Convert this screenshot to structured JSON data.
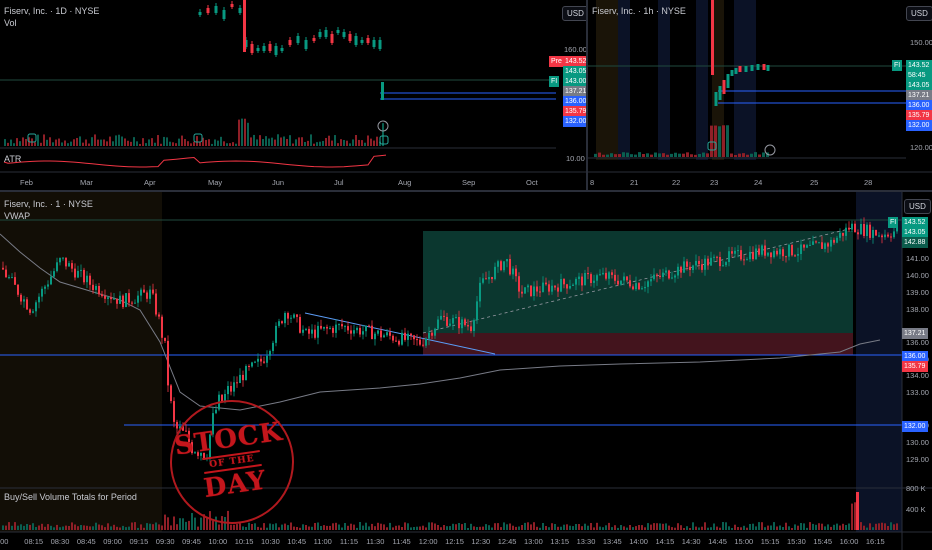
{
  "top_left": {
    "title": "Fiserv, Inc. · 1D · NYSE",
    "vol_label": "Vol",
    "atr_label": "ATR",
    "currency": "USD",
    "y_labels": [
      "160.00",
      "10.00"
    ],
    "x_labels": [
      "Feb",
      "Mar",
      "Apr",
      "May",
      "Jun",
      "Jul",
      "Aug",
      "Sep",
      "Oct"
    ],
    "price_tags": [
      {
        "text": "Pre",
        "text2": "143.52",
        "color": "#f23645"
      },
      {
        "text": "",
        "text2": "143.05",
        "color": "#089981"
      },
      {
        "text": "FI",
        "text2": "143.00",
        "color": "#089981"
      },
      {
        "text": "",
        "text2": "137.21",
        "color": "#787b86"
      },
      {
        "text": "",
        "text2": "136.00",
        "color": "#2962ff"
      },
      {
        "text": "",
        "text2": "135.79",
        "color": "#f23645"
      },
      {
        "text": "",
        "text2": "132.00",
        "color": "#2962ff"
      }
    ]
  },
  "top_right": {
    "title": "Fiserv, Inc. · 1h · NYSE",
    "currency": "USD",
    "y_labels": [
      "150.00",
      "120.00"
    ],
    "x_labels": [
      "8",
      "21",
      "22",
      "23",
      "24",
      "25",
      "28"
    ],
    "price_tags": [
      {
        "text": "FI",
        "text2": "143.52",
        "color": "#089981"
      },
      {
        "text": "",
        "text2": "58:45",
        "color": "#089981"
      },
      {
        "text": "",
        "text2": "143.05",
        "color": "#089981"
      },
      {
        "text": "",
        "text2": "137.21",
        "color": "#787b86"
      },
      {
        "text": "",
        "text2": "136.00",
        "color": "#2962ff"
      },
      {
        "text": "",
        "text2": "135.79",
        "color": "#f23645"
      },
      {
        "text": "",
        "text2": "132.00",
        "color": "#2962ff"
      }
    ]
  },
  "main": {
    "title": "Fiserv, Inc. · 1 · NYSE",
    "vwap_label": "VWAP",
    "currency": "USD",
    "volume_label": "Buy/Sell Volume Totals for Period",
    "stamp": {
      "line1": "STOCK",
      "line2": "OF THE",
      "line3": "DAY"
    },
    "y_labels": [
      "141.00",
      "140.00",
      "139.00",
      "138.00",
      "136.00",
      "135.00",
      "134.00",
      "133.00",
      "131.00",
      "130.00",
      "129.00"
    ],
    "price_tags": [
      {
        "text": "FI",
        "text2": "143.52",
        "color": "#089981"
      },
      {
        "text": "",
        "text2": "143.05",
        "color": "#089981"
      },
      {
        "text": "",
        "text2": "142.88",
        "color": "#0c5c4c"
      },
      {
        "text": "",
        "text2": "137.21",
        "color": "#787b86"
      },
      {
        "text": "",
        "text2": "136.00",
        "color": "#2962ff"
      },
      {
        "text": "",
        "text2": "135.79",
        "color": "#f23645"
      },
      {
        "text": "",
        "text2": "132.00",
        "color": "#2962ff"
      }
    ],
    "vol_y_labels": [
      "800 K",
      "400 K"
    ],
    "x_labels": [
      ":00",
      "08:15",
      "08:30",
      "08:45",
      "09:00",
      "09:15",
      "09:30",
      "09:45",
      "10:00",
      "10:15",
      "10:30",
      "10:45",
      "11:00",
      "11:15",
      "11:30",
      "11:45",
      "12:00",
      "12:15",
      "12:30",
      "12:45",
      "13:00",
      "13:15",
      "13:30",
      "13:45",
      "14:00",
      "14:15",
      "14:30",
      "14:45",
      "15:00",
      "15:15",
      "15:30",
      "15:45",
      "16:00",
      "16:15"
    ]
  },
  "colors": {
    "up": "#089981",
    "down": "#f23645",
    "blue": "#2962ff",
    "bg": "#000000"
  }
}
